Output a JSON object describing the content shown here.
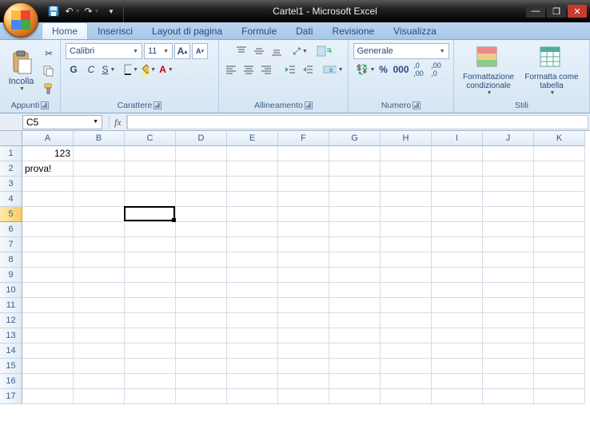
{
  "app_title": "Cartel1 - Microsoft Excel",
  "qat": {
    "save": "save",
    "undo": "undo",
    "redo": "redo"
  },
  "tabs": [
    "Home",
    "Inserisci",
    "Layout di pagina",
    "Formule",
    "Dati",
    "Revisione",
    "Visualizza"
  ],
  "active_tab": 0,
  "clipboard": {
    "paste": "Incolla",
    "title": "Appunti"
  },
  "font": {
    "name": "Calibri",
    "size": "11",
    "bold": "G",
    "italic": "C",
    "underline": "S",
    "title": "Carattere"
  },
  "alignment": {
    "title": "Allineamento"
  },
  "number": {
    "format": "Generale",
    "title": "Numero"
  },
  "styles": {
    "cond_format": "Formattazione condizionale",
    "format_table": "Formatta come tabella",
    "title": "Stili"
  },
  "namebox": "C5",
  "formula": "",
  "fx_label": "fx",
  "columns": [
    "A",
    "B",
    "C",
    "D",
    "E",
    "F",
    "G",
    "H",
    "I",
    "J",
    "K"
  ],
  "rows": [
    "1",
    "2",
    "3",
    "4",
    "5",
    "6",
    "7",
    "8",
    "9",
    "10",
    "11",
    "12",
    "13",
    "14",
    "15",
    "16",
    "17"
  ],
  "selected_row_index": 4,
  "selection": {
    "col": 2,
    "row": 4
  },
  "cells": {
    "A1": {
      "v": "123",
      "align": "num"
    },
    "A2": {
      "v": "prova!",
      "align": "text"
    }
  }
}
